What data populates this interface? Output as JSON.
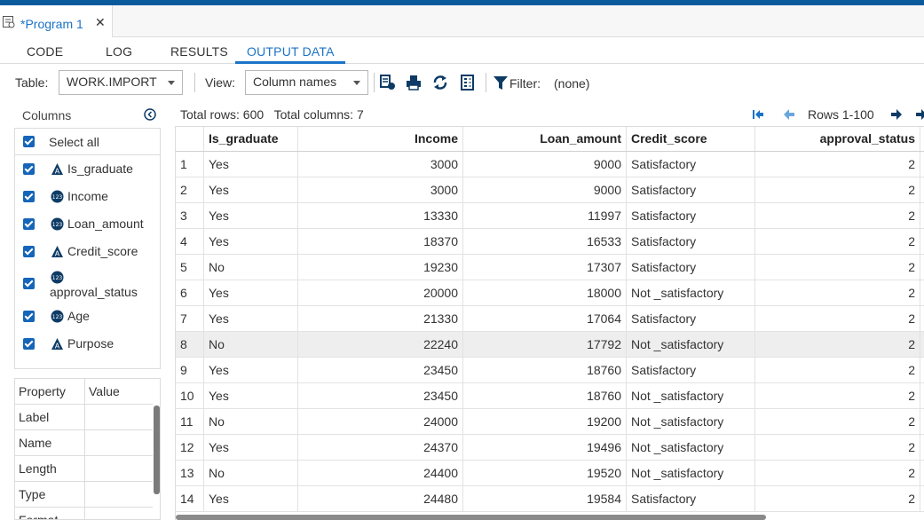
{
  "editor": {
    "tab_title": "*Program 1",
    "close_glyph": "✕",
    "icon": "program-icon"
  },
  "subtabs": [
    "CODE",
    "LOG",
    "RESULTS",
    "OUTPUT DATA"
  ],
  "active_subtab": "OUTPUT DATA",
  "toolbar": {
    "table_label": "Table:",
    "table_value": "WORK.IMPORT",
    "view_label": "View:",
    "view_value": "Column names",
    "filter_label": "Filter:",
    "filter_value": "(none)",
    "icons": [
      "table-properties-icon",
      "print-icon",
      "refresh-icon",
      "columns-icon",
      "filter-icon"
    ]
  },
  "columns_panel": {
    "title": "Columns",
    "select_all": "Select all",
    "items": [
      {
        "name": "Is_graduate",
        "type": "char"
      },
      {
        "name": "Income",
        "type": "num"
      },
      {
        "name": "Loan_amount",
        "type": "num"
      },
      {
        "name": "Credit_score",
        "type": "char"
      },
      {
        "name": "approval_status",
        "type": "num"
      },
      {
        "name": "Age",
        "type": "num"
      },
      {
        "name": "Purpose",
        "type": "char"
      }
    ],
    "type_badge_num": "123"
  },
  "property_panel": {
    "headers": [
      "Property",
      "Value"
    ],
    "rows": [
      "Label",
      "Name",
      "Length",
      "Type",
      "Format"
    ]
  },
  "grid_info": {
    "total_rows": "Total rows: 600",
    "total_columns": "Total columns: 7",
    "rows_range": "Rows 1-100"
  },
  "grid": {
    "headers": [
      "",
      "Is_graduate",
      "Income",
      "Loan_amount",
      "Credit_score",
      "approval_status"
    ],
    "rows": [
      [
        "1",
        "Yes",
        "3000",
        "9000",
        "Satisfactory",
        "2"
      ],
      [
        "2",
        "Yes",
        "3000",
        "9000",
        "Satisfactory",
        "2"
      ],
      [
        "3",
        "Yes",
        "13330",
        "11997",
        "Satisfactory",
        "2"
      ],
      [
        "4",
        "Yes",
        "18370",
        "16533",
        "Satisfactory",
        "2"
      ],
      [
        "5",
        "No",
        "19230",
        "17307",
        "Satisfactory",
        "2"
      ],
      [
        "6",
        "Yes",
        "20000",
        "18000",
        "Not _satisfactory",
        "2"
      ],
      [
        "7",
        "Yes",
        "21330",
        "17064",
        "Satisfactory",
        "2"
      ],
      [
        "8",
        "No",
        "22240",
        "17792",
        "Not _satisfactory",
        "2"
      ],
      [
        "9",
        "Yes",
        "23450",
        "18760",
        "Satisfactory",
        "2"
      ],
      [
        "10",
        "Yes",
        "23450",
        "18760",
        "Not _satisfactory",
        "2"
      ],
      [
        "11",
        "No",
        "24000",
        "19200",
        "Not _satisfactory",
        "2"
      ],
      [
        "12",
        "Yes",
        "24370",
        "19496",
        "Not _satisfactory",
        "2"
      ],
      [
        "13",
        "No",
        "24400",
        "19520",
        "Not _satisfactory",
        "2"
      ],
      [
        "14",
        "Yes",
        "24480",
        "19584",
        "Satisfactory",
        "2"
      ]
    ],
    "highlighted_row": "8"
  },
  "colors": {
    "accent": "#1a73c7",
    "topbar": "#0b5b9c",
    "checkbox": "#1565b8",
    "type_badge": "#0d3b66"
  }
}
